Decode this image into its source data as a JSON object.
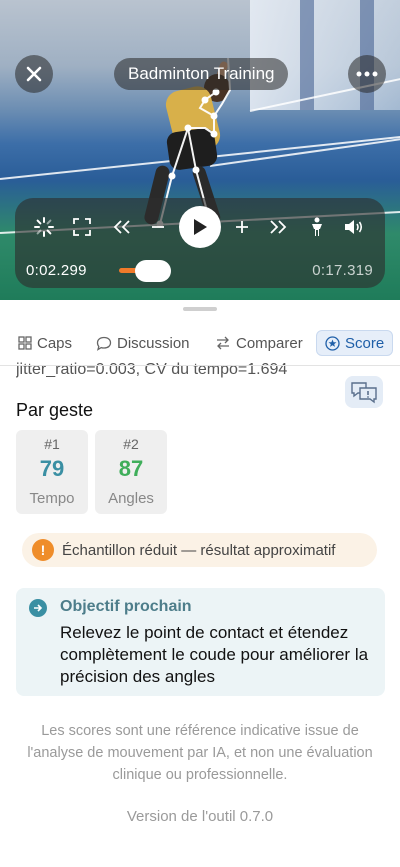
{
  "video": {
    "title": "Badminton Training",
    "current_time": "0:02.299",
    "total_time": "0:17.319",
    "progress": 0.133
  },
  "tabs": [
    {
      "label": "Caps",
      "icon": "grid-icon"
    },
    {
      "label": "Discussion",
      "icon": "chat-bubble-icon"
    },
    {
      "label": "Comparer",
      "icon": "swap-arrows-icon"
    },
    {
      "label": "Score",
      "icon": "star-badge-icon",
      "active": true
    }
  ],
  "metrics_line": "jitter_ratio=0.003, CV du tempo=1.694",
  "gestures": {
    "title": "Par geste",
    "items": [
      {
        "index": "#1",
        "score": "79",
        "label": "Tempo",
        "color": "#3a8fa3"
      },
      {
        "index": "#2",
        "score": "87",
        "label": "Angles",
        "color": "#3fae5a"
      }
    ]
  },
  "warning": "Échantillon réduit — résultat approximatif",
  "objective": {
    "title": "Objectif prochain",
    "body": "Relevez le point de contact et étendez complètement le coude pour améliorer la précision des angles"
  },
  "disclaimer": "Les scores sont une référence indicative issue de l'analyse de mouvement par IA, et non une évaluation clinique ou professionnelle.",
  "version": "Version de l'outil 0.7.0",
  "colors": {
    "accent": "#1f5fa8",
    "scrub": "#f07a2a",
    "warning": "#ef8d2a",
    "objective_icon": "#3a8fa3"
  }
}
